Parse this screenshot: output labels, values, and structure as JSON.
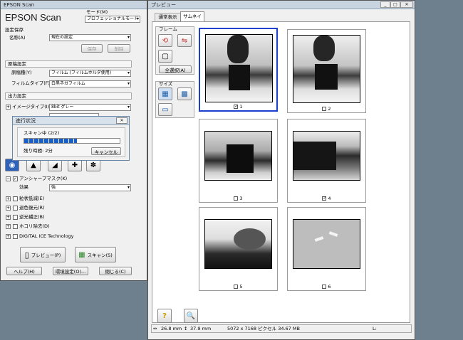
{
  "main_window": {
    "title": "EPSON Scan",
    "logo": "EPSON Scan",
    "mode_label": "モード(M)",
    "mode_value": "プロフェッショナルモード",
    "settings_save_header": "設定保存",
    "name_label": "名称(A)",
    "name_value": "現在の設定",
    "save_button": "保存",
    "delete_button": "削除",
    "doc_settings_header": "原稿設定",
    "doc_type_label": "原稿種(Y)",
    "doc_type_value": "フィルム (フィルムホルダ使用)",
    "film_type_label": "フィルムタイプ(F)",
    "film_type_value": "白黒ネガフィルム",
    "output_settings_header": "出力設定",
    "image_type_label": "イメージタイプ(I)",
    "image_type_value": "8bit グレー",
    "unsharp_mask_label": "アンシャープマスク(K)",
    "effect_label": "効果",
    "effect_value": "強",
    "grain_label": "粒状低減(E)",
    "color_restore_label": "退色復元(R)",
    "backlight_label": "逆光補正(B)",
    "dust_label": "ホコリ除去(D)",
    "digital_ice_label": "DIGITAL ICE Technology",
    "preview_button": "プレビュー(P)",
    "scan_button": "スキャン(S)",
    "help_button": "ヘルプ(H)",
    "env_button": "環境設定(O)...",
    "close_button": "閉じる(C)"
  },
  "progress_dialog": {
    "title": "進行状況",
    "status": "スキャン中 (2/2)",
    "remaining": "残り時間: 2分",
    "cancel_button": "キャンセル",
    "progress_fraction": 0.55
  },
  "preview_window": {
    "title": "プレビュー",
    "tabs": [
      "通常表示",
      "サムネイル"
    ],
    "frame_group": "フレーム",
    "select_all_button": "全選択(A)",
    "size_group": "サイズ",
    "thumbnails": [
      {
        "number": "1",
        "checked": true,
        "selected": true
      },
      {
        "number": "2",
        "checked": false,
        "selected": false
      },
      {
        "number": "3",
        "checked": false,
        "selected": false
      },
      {
        "number": "4",
        "checked": true,
        "selected": false
      },
      {
        "number": "5",
        "checked": false,
        "selected": false
      },
      {
        "number": "6",
        "checked": false,
        "selected": false
      }
    ],
    "status_width": "26.8 mm",
    "status_height": "37.9 mm",
    "status_pixels": "5072 x 7168 ピクセル 34.67 MB",
    "status_label": "L:"
  }
}
